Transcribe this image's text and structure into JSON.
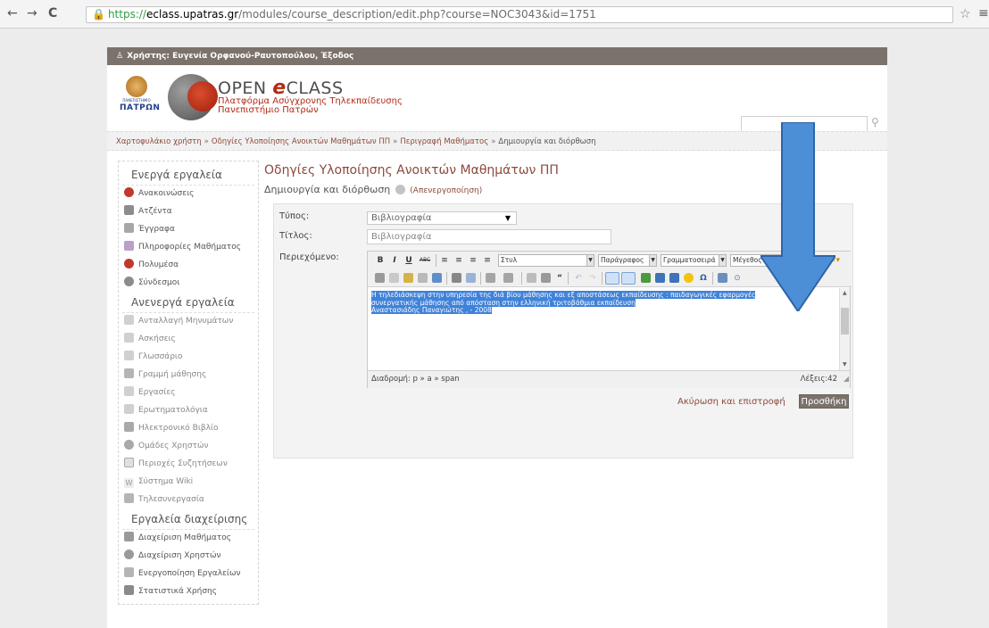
{
  "browser": {
    "url_scheme": "https://",
    "url_host": "eclass.upatras.gr",
    "url_path": "/modules/course_description/edit.php?course=NOC3043&id=1751",
    "back_icon": "←",
    "forward_icon": "→",
    "reload_icon": "C",
    "star_icon": "☆",
    "menu_icon": "≡"
  },
  "userbar": {
    "text": "Χρήστης: Ευγενία Ορφανού-Ραυτοπούλου, Έξοδος"
  },
  "header": {
    "uni_sub": "ΠΑΝΕΠΙΣΤΗΜΙΟ",
    "uni_name": "ΠΑΤΡΩΝ",
    "brand_open": "OPEN",
    "brand_e": "e",
    "brand_class": "CLASS",
    "subtitle1": "Πλατφόρμα Ασύγχρονης Τηλεκπαίδευσης",
    "subtitle2": "Πανεπιστήμιο Πατρών"
  },
  "breadcrumb": {
    "items": [
      "Χαρτοφυλάκιο χρήστη",
      "Οδηγίες Υλοποίησης Ανοικτών Μαθημάτων ΠΠ",
      "Περιγραφή Μαθήματος"
    ],
    "separator": "»",
    "current": "Δημιουργία και διόρθωση"
  },
  "sidebar": {
    "active_title": "Ενεργά εργαλεία",
    "active_items": [
      "Ανακοινώσεις",
      "Ατζέντα",
      "Έγγραφα",
      "Πληροφορίες Μαθήματος",
      "Πολυμέσα",
      "Σύνδεσμοι"
    ],
    "inactive_title": "Ανενεργά εργαλεία",
    "inactive_items": [
      "Ανταλλαγή Μηνυμάτων",
      "Ασκήσεις",
      "Γλωσσάριο",
      "Γραμμή μάθησης",
      "Εργασίες",
      "Ερωτηματολόγια",
      "Ηλεκτρονικό Βιβλίο",
      "Ομάδες Χρηστών",
      "Περιοχές Συζητήσεων",
      "Σύστημα Wiki",
      "Τηλεσυνεργασία"
    ],
    "admin_title": "Εργαλεία διαχείρισης",
    "admin_items": [
      "Διαχείριση Μαθήματος",
      "Διαχείριση Χρηστών",
      "Ενεργοποίηση Εργαλείων",
      "Στατιστικά Χρήσης"
    ]
  },
  "main": {
    "title": "Οδηγίες Υλοποίησης Ανοικτών Μαθημάτων ΠΠ",
    "subtitle": "Δημιουργία και διόρθωση",
    "deactivate": "(Απενεργοποίηση)"
  },
  "form": {
    "type_label": "Τύπος:",
    "type_value": "Βιβλιογραφία",
    "title_label": "Τίτλος:",
    "title_value": "Βιβλιογραφία",
    "content_label": "Περιεχόμενο:",
    "cancel": "Ακύρωση και επιστροφή",
    "submit": "Προσθήκη"
  },
  "editor": {
    "btn_bold": "B",
    "btn_italic": "I",
    "btn_underline": "U",
    "btn_strike": "ABC",
    "style_select": "Στυλ",
    "format_select": "Παράγραφος",
    "font_select": "Γραμματοσειρά",
    "size_select": "Μέγεθος Γραμμ",
    "content_line1": "Η τηλεδιάσκεψη στην υπηρεσία της διά βίου μάθησης και εξ αποστάσεως εκπαίδευσης : παιδαγωγικές εφαρμογές",
    "content_line2": "συνεργατικής μάθησης από απόσταση στην ελληνική τριτοβάθμια εκπαίδευση",
    "content_line3": "Αναστασιάδης Παναγιώτης , - 2008",
    "path": "Διαδρομή: p » a » span",
    "words": "Λέξεις:42"
  },
  "colors": {
    "brand_red": "#b42b17",
    "userbar_bg": "#7b726b",
    "arrow_blue": "#4d8fd6",
    "selection_blue": "#3f82d9"
  }
}
